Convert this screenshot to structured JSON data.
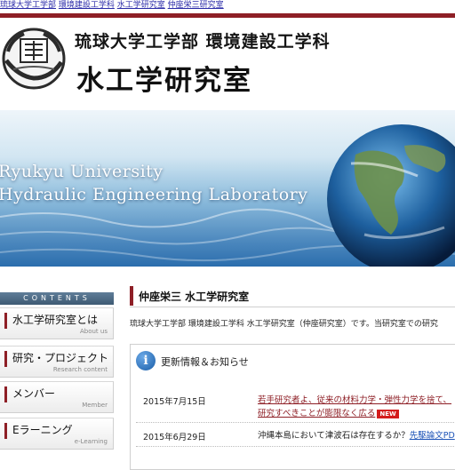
{
  "breadcrumb": {
    "items": [
      "琉球大学工学部",
      "環境建設工学科",
      "水工学研究室",
      "仲座栄三研究室"
    ]
  },
  "header": {
    "logo_alt": "琉球大学 校章",
    "title_line1": "琉球大学工学部 環境建設工学科",
    "title_line2": "水工学研究室"
  },
  "hero": {
    "line1": "Ryukyu University",
    "line2": "Hydraulic Engineering Laboratory"
  },
  "sidebar": {
    "header": "CONTENTS",
    "items": [
      {
        "label": "水工学研究室とは",
        "sub": "About us"
      },
      {
        "label": "研究・プロジェクト",
        "sub": "Research content"
      },
      {
        "label": "メンバー",
        "sub": "Member"
      },
      {
        "label": "Eラーニング",
        "sub": "e-Learning"
      }
    ]
  },
  "main": {
    "title": "仲座栄三 水工学研究室",
    "intro": "琉球大学工学部 環境建設工学科 水工学研究室（仲座研究室）です。当研究室での研究"
  },
  "news": {
    "title": "更新情報＆お知らせ",
    "icon": "info-icon",
    "new_badge": "NEW",
    "rows": [
      {
        "date": "2015年7月15日",
        "text1": "若手研究者よ、従来の材料力学・弾性力学を捨て、",
        "text2": "研究すべきことが膨限なく広る"
      },
      {
        "date": "2015年6月29日",
        "text_plain": "沖縄本島において津波石は存在するか？",
        "text_link": "先駆論文PD"
      }
    ]
  },
  "colors": {
    "accent": "#8e1f26",
    "link": "#2a2aa8",
    "badge": "#d41c1c"
  }
}
